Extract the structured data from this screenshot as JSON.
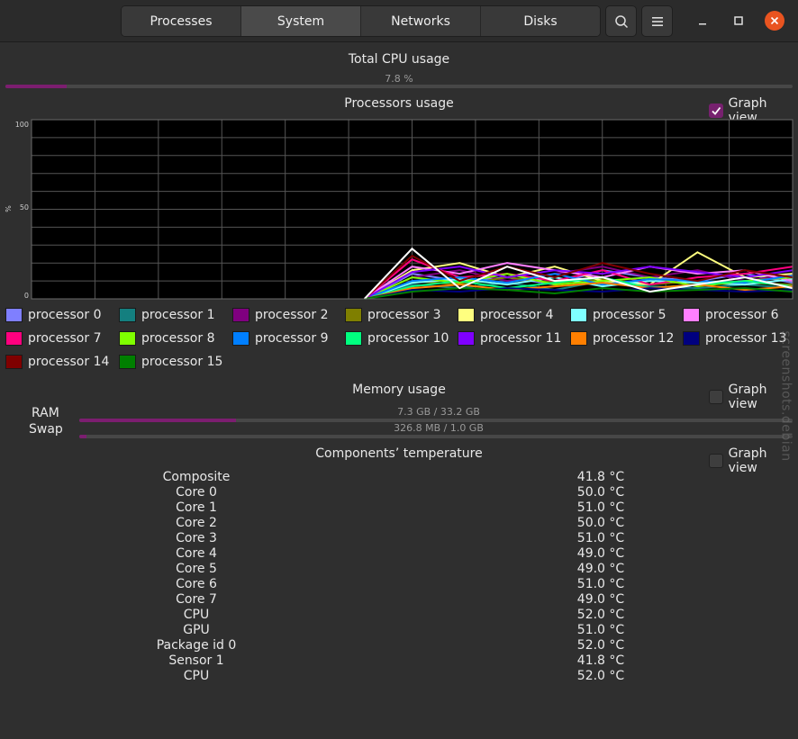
{
  "header": {
    "tabs": [
      {
        "label": "Processes",
        "active": false
      },
      {
        "label": "System",
        "active": true
      },
      {
        "label": "Networks",
        "active": false
      },
      {
        "label": "Disks",
        "active": false
      }
    ],
    "icons": {
      "search": "search-icon",
      "menu": "hamburger-menu-icon",
      "minimize": "minimize-icon",
      "maximize": "maximize-icon",
      "close": "close-icon"
    }
  },
  "cpu_total": {
    "title": "Total CPU usage",
    "value_label": "7.8 %",
    "fraction": 0.078
  },
  "processors": {
    "title": "Processors usage",
    "graph_view_label": "Graph view",
    "graph_view_checked": true,
    "axis": {
      "top": "100",
      "mid": "50",
      "bottom": "0",
      "unit": "%"
    },
    "legend": [
      {
        "label": "processor 0",
        "color": "#7f7fff"
      },
      {
        "label": "processor 1",
        "color": "#147f7f"
      },
      {
        "label": "processor 2",
        "color": "#7f007f"
      },
      {
        "label": "processor 3",
        "color": "#7f7f00"
      },
      {
        "label": "processor 4",
        "color": "#ffff7f"
      },
      {
        "label": "processor 5",
        "color": "#7fffff"
      },
      {
        "label": "processor 6",
        "color": "#ff7fff"
      },
      {
        "label": "processor 7",
        "color": "#ff007f"
      },
      {
        "label": "processor 8",
        "color": "#7fff00"
      },
      {
        "label": "processor 9",
        "color": "#007fff"
      },
      {
        "label": "processor 10",
        "color": "#00ff7f"
      },
      {
        "label": "processor 11",
        "color": "#7f00ff"
      },
      {
        "label": "processor 12",
        "color": "#ff7f00"
      },
      {
        "label": "processor 13",
        "color": "#00007f"
      },
      {
        "label": "processor 14",
        "color": "#7f0000"
      },
      {
        "label": "processor 15",
        "color": "#007f00"
      }
    ]
  },
  "chart_data": {
    "type": "line",
    "ylim": [
      0,
      100
    ],
    "ylabel": "%",
    "yticks": [
      "0",
      "50",
      "100"
    ],
    "grid": true,
    "x": [
      0,
      1,
      2,
      3,
      4,
      5,
      6,
      7,
      8,
      9,
      10,
      11,
      12,
      13,
      14,
      15,
      16
    ],
    "series": [
      {
        "name": "processor 0",
        "color": "#7f7fff",
        "values": [
          null,
          null,
          null,
          null,
          null,
          null,
          null,
          0,
          14,
          10,
          12,
          8,
          16,
          12,
          10,
          14,
          9
        ]
      },
      {
        "name": "processor 1",
        "color": "#147f7f",
        "values": [
          null,
          null,
          null,
          null,
          null,
          null,
          null,
          0,
          8,
          6,
          9,
          5,
          10,
          7,
          6,
          8,
          6
        ]
      },
      {
        "name": "processor 2",
        "color": "#7f007f",
        "values": [
          null,
          null,
          null,
          null,
          null,
          null,
          null,
          0,
          12,
          16,
          10,
          14,
          18,
          12,
          16,
          10,
          14
        ]
      },
      {
        "name": "processor 3",
        "color": "#7f7f00",
        "values": [
          null,
          null,
          null,
          null,
          null,
          null,
          null,
          0,
          10,
          8,
          12,
          9,
          11,
          8,
          10,
          9,
          8
        ]
      },
      {
        "name": "processor 4",
        "color": "#ffff7f",
        "values": [
          null,
          null,
          null,
          null,
          null,
          null,
          null,
          0,
          16,
          20,
          12,
          18,
          10,
          8,
          26,
          12,
          14
        ]
      },
      {
        "name": "processor 5",
        "color": "#7fffff",
        "values": [
          null,
          null,
          null,
          null,
          null,
          null,
          null,
          0,
          9,
          11,
          8,
          12,
          7,
          10,
          9,
          8,
          11
        ]
      },
      {
        "name": "processor 6",
        "color": "#ff7fff",
        "values": [
          null,
          null,
          null,
          null,
          null,
          null,
          null,
          0,
          18,
          14,
          20,
          16,
          12,
          18,
          14,
          16,
          10
        ]
      },
      {
        "name": "processor 7",
        "color": "#ff007f",
        "values": [
          null,
          null,
          null,
          null,
          null,
          null,
          null,
          0,
          22,
          12,
          14,
          10,
          16,
          8,
          12,
          14,
          18
        ]
      },
      {
        "name": "processor 8",
        "color": "#7fff00",
        "values": [
          null,
          null,
          null,
          null,
          null,
          null,
          null,
          0,
          12,
          9,
          14,
          8,
          10,
          12,
          7,
          10,
          12
        ]
      },
      {
        "name": "processor 9",
        "color": "#007fff",
        "values": [
          null,
          null,
          null,
          null,
          null,
          null,
          null,
          0,
          10,
          12,
          9,
          14,
          8,
          11,
          10,
          9,
          13
        ]
      },
      {
        "name": "processor 10",
        "color": "#00ff7f",
        "values": [
          null,
          null,
          null,
          null,
          null,
          null,
          null,
          0,
          7,
          10,
          6,
          9,
          12,
          6,
          8,
          10,
          7
        ]
      },
      {
        "name": "processor 11",
        "color": "#7f00ff",
        "values": [
          null,
          null,
          null,
          null,
          null,
          null,
          null,
          0,
          15,
          18,
          12,
          16,
          14,
          18,
          15,
          12,
          16
        ]
      },
      {
        "name": "processor 12",
        "color": "#ff7f00",
        "values": [
          null,
          null,
          null,
          null,
          null,
          null,
          null,
          0,
          6,
          8,
          5,
          7,
          9,
          6,
          8,
          5,
          7
        ]
      },
      {
        "name": "processor 13",
        "color": "#00007f",
        "values": [
          null,
          null,
          null,
          null,
          null,
          null,
          null,
          0,
          5,
          4,
          6,
          5,
          4,
          6,
          5,
          4,
          5
        ]
      },
      {
        "name": "processor 14",
        "color": "#7f0000",
        "values": [
          null,
          null,
          null,
          null,
          null,
          null,
          null,
          0,
          24,
          10,
          18,
          12,
          20,
          14,
          10,
          16,
          12
        ]
      },
      {
        "name": "processor 15",
        "color": "#007f00",
        "values": [
          null,
          null,
          null,
          null,
          null,
          null,
          null,
          0,
          4,
          6,
          5,
          3,
          6,
          4,
          5,
          6,
          4
        ]
      },
      {
        "name": "",
        "color": "#ffffff",
        "values": [
          null,
          null,
          null,
          null,
          null,
          null,
          null,
          0,
          28,
          6,
          18,
          10,
          12,
          4,
          8,
          12,
          6
        ]
      }
    ]
  },
  "memory": {
    "title": "Memory usage",
    "graph_view_label": "Graph view",
    "graph_view_checked": false,
    "ram_label": "RAM",
    "ram_value": "7.3 GB / 33.2 GB",
    "ram_fraction": 0.22,
    "swap_label": "Swap",
    "swap_value": "326.8 MB / 1.0 GB",
    "swap_fraction": 0.01
  },
  "temperature": {
    "title": "Components’ temperature",
    "graph_view_label": "Graph view",
    "graph_view_checked": false,
    "rows": [
      {
        "name": "Composite",
        "value": "41.8 °C"
      },
      {
        "name": "Core 0",
        "value": "50.0 °C"
      },
      {
        "name": "Core 1",
        "value": "51.0 °C"
      },
      {
        "name": "Core 2",
        "value": "50.0 °C"
      },
      {
        "name": "Core 3",
        "value": "51.0 °C"
      },
      {
        "name": "Core 4",
        "value": "49.0 °C"
      },
      {
        "name": "Core 5",
        "value": "49.0 °C"
      },
      {
        "name": "Core 6",
        "value": "51.0 °C"
      },
      {
        "name": "Core 7",
        "value": "49.0 °C"
      },
      {
        "name": "CPU",
        "value": "52.0 °C"
      },
      {
        "name": "GPU",
        "value": "51.0 °C"
      },
      {
        "name": "Package id 0",
        "value": "52.0 °C"
      },
      {
        "name": "Sensor 1",
        "value": "41.8 °C"
      },
      {
        "name": "CPU",
        "value": "52.0 °C"
      }
    ]
  },
  "watermark": {
    "text": "screenshots.debian"
  }
}
